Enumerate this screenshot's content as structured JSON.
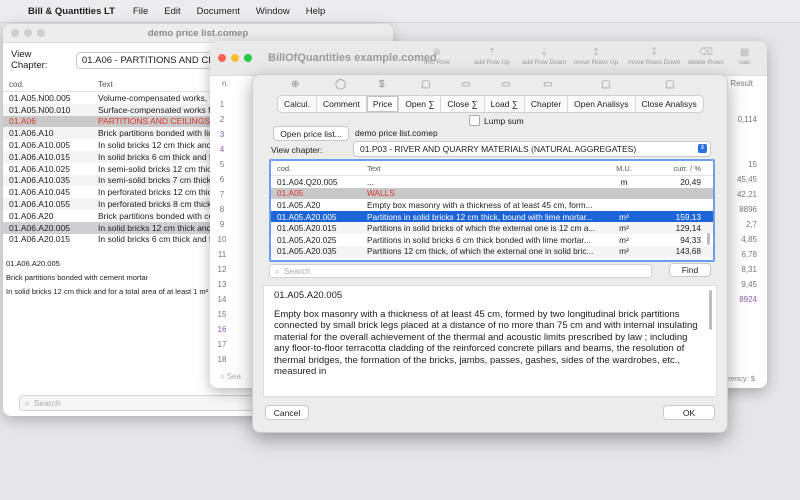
{
  "menubar": {
    "app_name": "Bill & Quantities LT",
    "items": [
      "File",
      "Edit",
      "Document",
      "Window",
      "Help"
    ]
  },
  "price_window": {
    "title": "demo price list.comep",
    "view_chapter_label": "View Chapter:",
    "view_chapter_value": "01.A06 - PARTITIONS AND CEILINGS",
    "columns": [
      "cod.",
      "Text"
    ],
    "rows": [
      {
        "code": "01.A05.N00.005",
        "text": "Volume-compensated works, fo"
      },
      {
        "code": "01.A05.N00.010",
        "text": "Surface-compensated works fo"
      },
      {
        "code": "01.A06",
        "text": "PARTITIONS AND CEILINGS"
      },
      {
        "code": "01.A06.A10",
        "text": "Brick partitions bonded with lim"
      },
      {
        "code": "01.A06.A10.005",
        "text": "In solid bricks 12 cm thick and t"
      },
      {
        "code": "01.A06.A10.015",
        "text": "In solid bricks 6 cm thick and fo"
      },
      {
        "code": "01.A06.A10.025",
        "text": "In semi-solid bricks 12 cm thick"
      },
      {
        "code": "01.A06.A10.035",
        "text": "In semi-solid bricks 7 cm thick"
      },
      {
        "code": "01.A06.A10.045",
        "text": "In perforated bricks 12 cm thic"
      },
      {
        "code": "01.A06.A10.055",
        "text": "In perforated bricks 8 cm thick"
      },
      {
        "code": "01.A06.A20",
        "text": "Brick partitions bonded with ce"
      },
      {
        "code": "01.A06.A20.005",
        "text": "In solid bricks 12 cm thick and f"
      },
      {
        "code": "01.A06.A20.015",
        "text": "In solid bricks 6 cm thick and fo"
      }
    ],
    "desc_lines": [
      "01.A06.A20.005",
      "Brick partitions bonded with cement mortar",
      "In solid bricks 12 cm thick and for a total area of at least 1 m²"
    ],
    "search_placeholder": "Search"
  },
  "bill_window": {
    "title": "BillOfQuantities example.comed",
    "toolbar": [
      "Info Row",
      "add Row Up",
      "add Row Down",
      "move Rows Up",
      "move Rows Down",
      "delete Rows",
      "calc"
    ],
    "col_n": "n.",
    "col_result": "Result",
    "row_numbers": [
      "1",
      "2",
      "3",
      "4",
      "5",
      "6",
      "7",
      "8",
      "9",
      "10",
      "11",
      "12",
      "13",
      "14",
      "15",
      "16",
      "17",
      "18"
    ],
    "right_values": [
      "",
      "0,114",
      "",
      "",
      "15",
      "45,45",
      "42,21",
      "8896",
      "2,7",
      "4,85",
      "6,78",
      "8,31",
      "9,45",
      "8924",
      "",
      "",
      "",
      ""
    ],
    "currency_label": "rrency: $",
    "search_fragment": "Sea"
  },
  "dialog": {
    "tabs": [
      "Calcul.",
      "Comment",
      "Price",
      "Open ∑",
      "Close ∑",
      "Load ∑",
      "Chapter",
      "Open Analisys",
      "Close Analisys"
    ],
    "active_tab": "Price",
    "lump_sum_label": "Lump sum",
    "open_price_list_button": "Open price list...",
    "price_list_name": "demo price list.comep",
    "view_chapter_label": "View chapter:",
    "view_chapter_value": "01.P03 - RIVER AND QUARRY MATERIALS (NATURAL AGGREGATES)",
    "columns": {
      "code": "cod.",
      "text": "Text",
      "mu": "M.U.",
      "curr": "curr. / %"
    },
    "rows": [
      {
        "code": "01.A04.Q20.005",
        "text": "...",
        "mu": "m",
        "curr": "20,49",
        "type": "normal"
      },
      {
        "code": "01.A05",
        "text": "WALLS",
        "mu": "",
        "curr": "",
        "type": "chapter"
      },
      {
        "code": "01.A05.A20",
        "text": "Empty box masonry with a thickness of at least 45 cm, form...",
        "mu": "",
        "curr": "",
        "type": "normal"
      },
      {
        "code": "01.A05.A20.005",
        "text": "Partitions in solid bricks 12 cm thick, bound with lime mortar...",
        "mu": "m²",
        "curr": "159,13",
        "type": "selected"
      },
      {
        "code": "01.A05.A20.015",
        "text": "Partitions in solid bricks of which the external one is 12 cm a...",
        "mu": "m²",
        "curr": "129,14",
        "type": "alt"
      },
      {
        "code": "01.A05.A20.025",
        "text": "Partitions in solid bricks 6 cm thick bonded with lime mortar...",
        "mu": "m²",
        "curr": "94,33",
        "type": "normal"
      },
      {
        "code": "01.A05.A20.035",
        "text": "Partitions 12 cm thick, of which the external one in solid bric...",
        "mu": "m²",
        "curr": "143,68",
        "type": "alt"
      }
    ],
    "search_placeholder": "Search",
    "find_button": "Find",
    "desc_code": "01.A05.A20.005",
    "desc_text": "Empty box masonry with a thickness of at least 45 cm, formed by two longitudinal brick partitions connected by small brick legs placed at a distance of no more than 75 cm and with internal insulating material for the overall achievement of the thermal and acoustic limits prescribed by law ; including any floor-to-floor terracotta cladding of the reinforced concrete pillars and beams, the resolution of thermal bridges, the formation of the bricks, jambs, passes, gashes, sides of the wardrobes, etc., measured in",
    "cancel_button": "Cancel",
    "ok_button": "OK"
  }
}
